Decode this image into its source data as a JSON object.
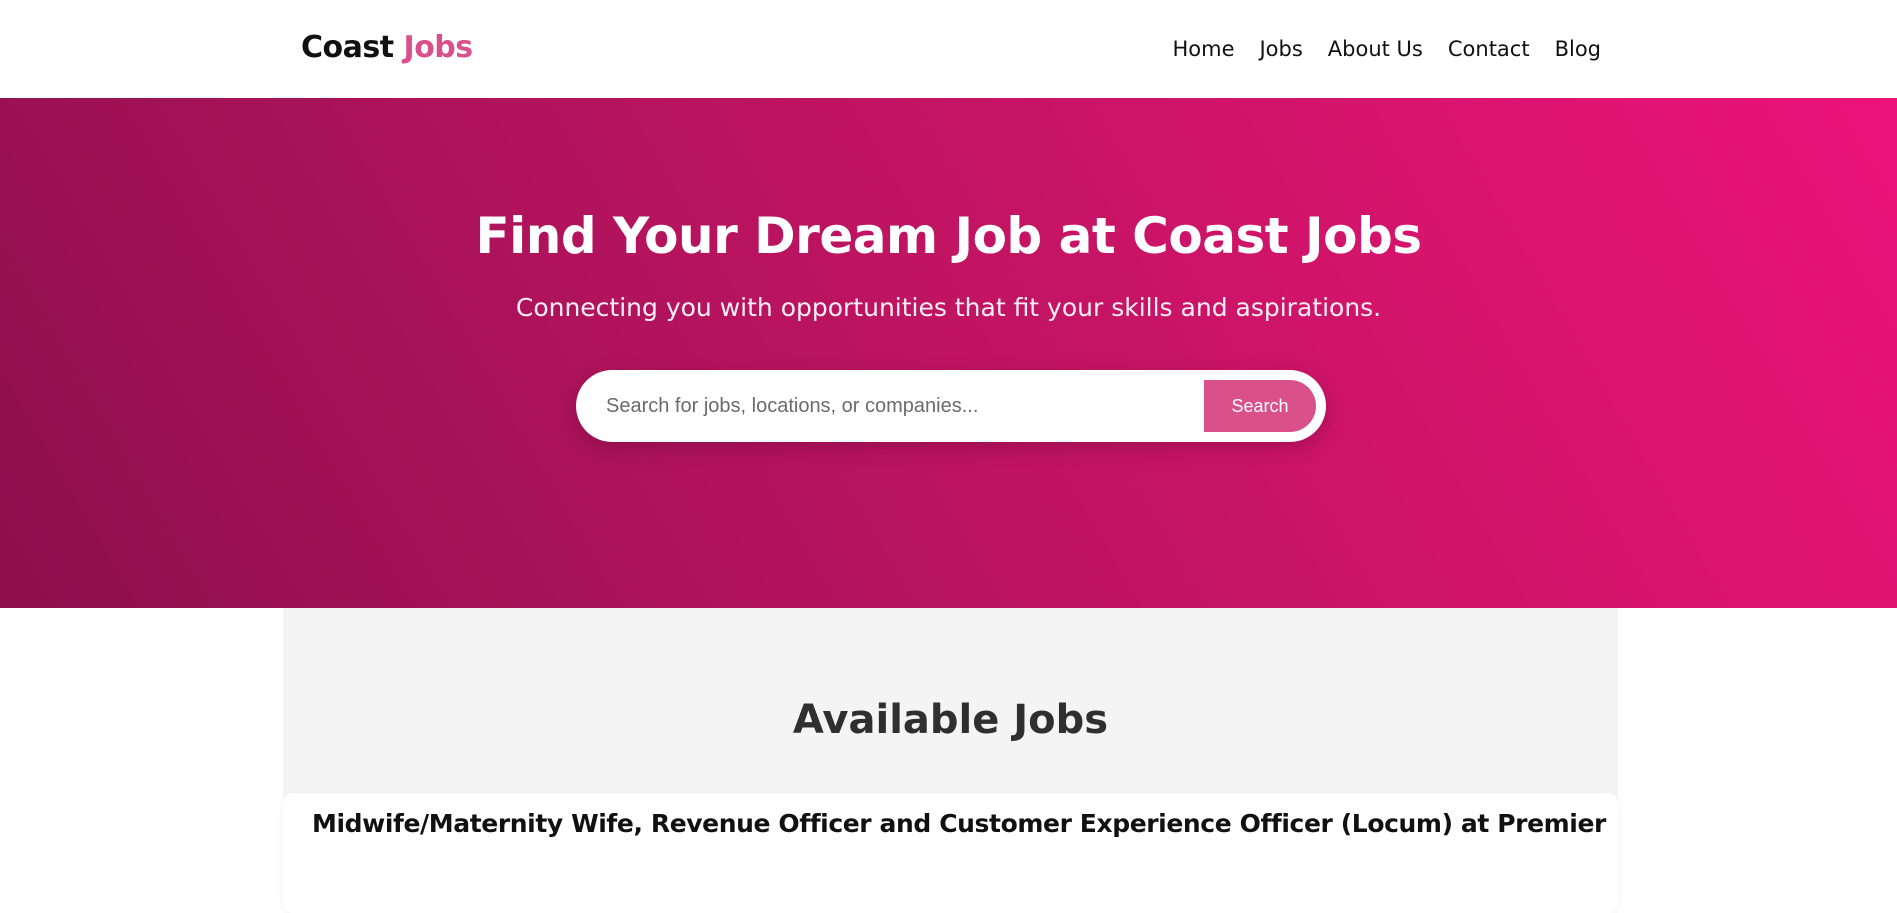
{
  "header": {
    "logo_first": "Coast",
    "logo_second": "Jobs",
    "nav": [
      "Home",
      "Jobs",
      "About Us",
      "Contact",
      "Blog"
    ]
  },
  "hero": {
    "title": "Find Your Dream Job at Coast Jobs",
    "subtitle": "Connecting you with opportunities that fit your skills and aspirations.",
    "search": {
      "placeholder": "Search for jobs, locations, or companies...",
      "value": "",
      "button_label": "Search"
    }
  },
  "jobs": {
    "section_title": "Available Jobs",
    "items": [
      {
        "title": "Midwife/Maternity Wife, Revenue Officer and Customer Experience Officer (Locum) at Premier"
      }
    ]
  },
  "colors": {
    "accent": "#d9508a",
    "hero_gradient_start": "#8d0f4c",
    "hero_gradient_end": "#ec137a",
    "section_background": "#f4f4f4"
  }
}
